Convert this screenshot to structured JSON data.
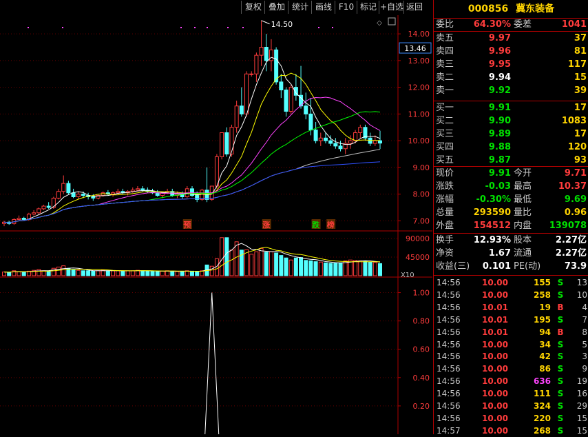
{
  "toolbar": {
    "buttons": [
      "复权",
      "叠加",
      "统计",
      "画线",
      "F10",
      "标记",
      "+自选",
      "返回"
    ]
  },
  "stock": {
    "code": "000856",
    "name": "冀东装备"
  },
  "order_book": {
    "weibi_label": "委比",
    "weibi_value": "64.30%",
    "weicha_label": "委差",
    "weicha_value": "1041",
    "asks": [
      {
        "label": "卖五",
        "price": "9.97",
        "volume": "37"
      },
      {
        "label": "卖四",
        "price": "9.96",
        "volume": "81"
      },
      {
        "label": "卖三",
        "price": "9.95",
        "volume": "117"
      },
      {
        "label": "卖二",
        "price": "9.94",
        "volume": "15"
      },
      {
        "label": "卖一",
        "price": "9.92",
        "volume": "39"
      }
    ],
    "bids": [
      {
        "label": "买一",
        "price": "9.91",
        "volume": "17"
      },
      {
        "label": "买二",
        "price": "9.90",
        "volume": "1083"
      },
      {
        "label": "买三",
        "price": "9.89",
        "volume": "17"
      },
      {
        "label": "买四",
        "price": "9.88",
        "volume": "120"
      },
      {
        "label": "买五",
        "price": "9.87",
        "volume": "93"
      }
    ]
  },
  "quote": {
    "rows": [
      {
        "l1": "现价",
        "v1": "9.91",
        "l2": "今开",
        "v2": "9.71"
      },
      {
        "l1": "涨跌",
        "v1": "-0.03",
        "l2": "最高",
        "v2": "10.37"
      },
      {
        "l1": "涨幅",
        "v1": "-0.30%",
        "l2": "最低",
        "v2": "9.69"
      },
      {
        "l1": "总量",
        "v1": "293590",
        "l2": "量比",
        "v2": "0.96"
      },
      {
        "l1": "外盘",
        "v1": "154512",
        "l2": "内盘",
        "v2": "139078"
      }
    ],
    "rows2": [
      {
        "l1": "换手",
        "v1": "12.93%",
        "l2": "股本",
        "v2": "2.27亿"
      },
      {
        "l1": "净资",
        "v1": "1.67",
        "l2": "流通",
        "v2": "2.27亿"
      },
      {
        "l1": "收益(三)",
        "v1": "0.101",
        "l2": "PE(动)",
        "v2": "73.9"
      }
    ]
  },
  "ticks": [
    {
      "time": "14:56",
      "price": "10.00",
      "volume": "155",
      "side": "S",
      "num": "13"
    },
    {
      "time": "14:56",
      "price": "10.00",
      "volume": "258",
      "side": "S",
      "num": "10"
    },
    {
      "time": "14:56",
      "price": "10.01",
      "volume": "19",
      "side": "B",
      "num": "4"
    },
    {
      "time": "14:56",
      "price": "10.01",
      "volume": "195",
      "side": "S",
      "num": "7"
    },
    {
      "time": "14:56",
      "price": "10.01",
      "volume": "94",
      "side": "B",
      "num": "8"
    },
    {
      "time": "14:56",
      "price": "10.00",
      "volume": "34",
      "side": "S",
      "num": "5"
    },
    {
      "time": "14:56",
      "price": "10.00",
      "volume": "42",
      "side": "S",
      "num": "3"
    },
    {
      "time": "14:56",
      "price": "10.00",
      "volume": "86",
      "side": "S",
      "num": "9"
    },
    {
      "time": "14:56",
      "price": "10.00",
      "volume": "636",
      "side": "S",
      "num": "19"
    },
    {
      "time": "14:56",
      "price": "10.00",
      "volume": "111",
      "side": "S",
      "num": "16"
    },
    {
      "time": "14:56",
      "price": "10.00",
      "volume": "324",
      "side": "S",
      "num": "29"
    },
    {
      "time": "14:56",
      "price": "10.00",
      "volume": "220",
      "side": "S",
      "num": "15"
    },
    {
      "time": "14:57",
      "price": "10.00",
      "volume": "268",
      "side": "S",
      "num": "15"
    }
  ],
  "chart_data": [
    {
      "type": "candlestick",
      "price_axis_ticks": [
        "14.00",
        "13.00",
        "12.00",
        "11.00",
        "10.00",
        "9.00",
        "8.00",
        "7.00"
      ],
      "ylim": [
        6.7,
        14.7
      ],
      "current_price_label": "13.46",
      "high_annotation": "14.50",
      "event_markers": [
        {
          "text": "预",
          "color": "#ff3c3c"
        },
        {
          "text": "涨",
          "color": "#ff3c3c"
        },
        {
          "text": "跌",
          "color": "#00e000"
        },
        {
          "text": "榜",
          "color": "#ff3c3c"
        }
      ],
      "candles": [
        [
          6.9,
          7.0,
          6.8,
          6.95
        ],
        [
          6.95,
          7.0,
          6.85,
          6.9
        ],
        [
          6.9,
          7.1,
          6.85,
          7.05
        ],
        [
          7.05,
          7.2,
          7.0,
          7.1
        ],
        [
          7.1,
          7.15,
          7.0,
          7.05
        ],
        [
          7.05,
          7.3,
          7.0,
          7.25
        ],
        [
          7.25,
          7.4,
          7.2,
          7.3
        ],
        [
          7.3,
          7.5,
          7.25,
          7.45
        ],
        [
          7.45,
          7.6,
          7.4,
          7.55
        ],
        [
          7.55,
          7.7,
          7.45,
          7.5
        ],
        [
          7.5,
          7.9,
          7.45,
          7.85
        ],
        [
          7.85,
          8.2,
          7.8,
          8.1
        ],
        [
          8.1,
          8.7,
          8.0,
          8.4
        ],
        [
          8.4,
          8.5,
          8.0,
          8.05
        ],
        [
          8.05,
          8.2,
          7.85,
          7.9
        ],
        [
          7.9,
          8.1,
          7.8,
          8.0
        ],
        [
          8.0,
          8.1,
          7.85,
          7.95
        ],
        [
          7.95,
          8.05,
          7.8,
          7.9
        ],
        [
          7.9,
          8.0,
          7.75,
          7.85
        ],
        [
          7.85,
          8.0,
          7.8,
          7.95
        ],
        [
          7.95,
          8.1,
          7.9,
          8.05
        ],
        [
          8.05,
          8.15,
          7.95,
          8.0
        ],
        [
          8.0,
          8.1,
          7.9,
          8.05
        ],
        [
          8.05,
          8.2,
          8.0,
          8.1
        ],
        [
          8.1,
          8.2,
          8.0,
          8.05
        ],
        [
          8.05,
          8.15,
          7.95,
          8.1
        ],
        [
          8.1,
          8.25,
          8.05,
          8.15
        ],
        [
          8.15,
          8.3,
          8.1,
          8.2
        ],
        [
          8.2,
          8.3,
          8.1,
          8.15
        ],
        [
          8.15,
          8.25,
          8.05,
          8.1
        ],
        [
          8.1,
          8.2,
          8.0,
          8.05
        ],
        [
          8.05,
          8.15,
          7.9,
          7.95
        ],
        [
          7.95,
          8.1,
          7.85,
          8.05
        ],
        [
          8.05,
          8.2,
          8.0,
          8.1
        ],
        [
          8.1,
          8.2,
          7.9,
          7.95
        ],
        [
          7.95,
          8.1,
          7.85,
          8.0
        ],
        [
          8.0,
          8.1,
          7.8,
          7.9
        ],
        [
          7.9,
          8.3,
          7.85,
          8.2
        ],
        [
          8.2,
          8.3,
          7.9,
          7.95
        ],
        [
          7.95,
          8.1,
          7.7,
          7.8
        ],
        [
          7.8,
          8.2,
          7.75,
          8.15
        ],
        [
          8.15,
          9.0,
          7.7,
          7.8
        ],
        [
          7.8,
          8.2,
          7.75,
          8.3
        ],
        [
          8.3,
          9.5,
          8.2,
          9.4
        ],
        [
          9.4,
          10.3,
          9.3,
          10.3
        ],
        [
          10.3,
          10.5,
          9.4,
          9.5
        ],
        [
          9.5,
          10.6,
          9.4,
          10.5
        ],
        [
          10.5,
          11.5,
          10.3,
          11.3
        ],
        [
          11.3,
          12.0,
          10.9,
          11.0
        ],
        [
          11.0,
          12.6,
          10.9,
          12.5
        ],
        [
          12.5,
          12.6,
          12.4,
          12.5
        ],
        [
          12.5,
          13.3,
          12.2,
          13.2
        ],
        [
          13.2,
          14.5,
          12.8,
          13.5
        ],
        [
          13.5,
          14.0,
          12.6,
          13.0
        ],
        [
          13.0,
          13.8,
          12.6,
          13.4
        ],
        [
          13.4,
          13.5,
          12.1,
          12.2
        ],
        [
          12.2,
          12.5,
          11.6,
          11.9
        ],
        [
          11.9,
          12.0,
          10.9,
          11.1
        ],
        [
          11.1,
          12.1,
          11.0,
          12.0
        ],
        [
          12.0,
          12.5,
          11.5,
          11.7
        ],
        [
          11.7,
          12.8,
          11.2,
          11.3
        ],
        [
          11.3,
          11.8,
          10.8,
          11.0
        ],
        [
          11.0,
          11.6,
          10.2,
          10.4
        ],
        [
          10.4,
          10.7,
          9.9,
          10.0
        ],
        [
          10.0,
          10.3,
          9.8,
          10.1
        ],
        [
          10.1,
          10.3,
          9.9,
          10.0
        ],
        [
          10.0,
          10.2,
          9.8,
          9.9
        ],
        [
          9.9,
          10.1,
          9.7,
          9.8
        ],
        [
          9.8,
          10.0,
          9.6,
          9.7
        ],
        [
          9.7,
          10.1,
          9.5,
          9.9
        ],
        [
          9.9,
          10.2,
          9.7,
          10.0
        ],
        [
          10.0,
          10.4,
          9.9,
          10.3
        ],
        [
          10.3,
          10.6,
          10.1,
          10.5
        ],
        [
          10.5,
          10.6,
          10.0,
          10.1
        ],
        [
          10.1,
          10.3,
          9.8,
          9.9
        ],
        [
          9.9,
          10.2,
          9.8,
          10.0
        ],
        [
          10.0,
          10.37,
          9.69,
          9.91
        ]
      ]
    },
    {
      "type": "bar",
      "volume_axis_ticks": [
        "90000",
        "45000"
      ],
      "unit_label": "X10",
      "values": [
        9000,
        8000,
        12000,
        10000,
        9000,
        11000,
        13000,
        15000,
        12000,
        11000,
        18000,
        21000,
        24000,
        17000,
        14000,
        13000,
        12000,
        12000,
        11000,
        12000,
        13000,
        12000,
        12000,
        12000,
        11000,
        12000,
        12000,
        13000,
        12000,
        11000,
        11000,
        10000,
        11000,
        12000,
        11000,
        10000,
        10000,
        12000,
        11000,
        10000,
        12000,
        26000,
        23000,
        41000,
        92000,
        92000,
        62000,
        82000,
        62000,
        63000,
        52000,
        58000,
        66000,
        57000,
        58000,
        55000,
        49000,
        43000,
        38000,
        43000,
        44000,
        37000,
        36000,
        34000,
        33000,
        31000,
        30000,
        30000,
        31000,
        36000,
        38000,
        37000,
        36000,
        35000,
        33000,
        32000,
        29359
      ]
    },
    {
      "type": "line",
      "indicator_axis_ticks": [
        "1.00",
        "0.80",
        "0.60",
        "0.40",
        "0.20"
      ],
      "ylim": [
        0,
        1.1
      ],
      "spike": {
        "peak": 1.0
      }
    }
  ]
}
